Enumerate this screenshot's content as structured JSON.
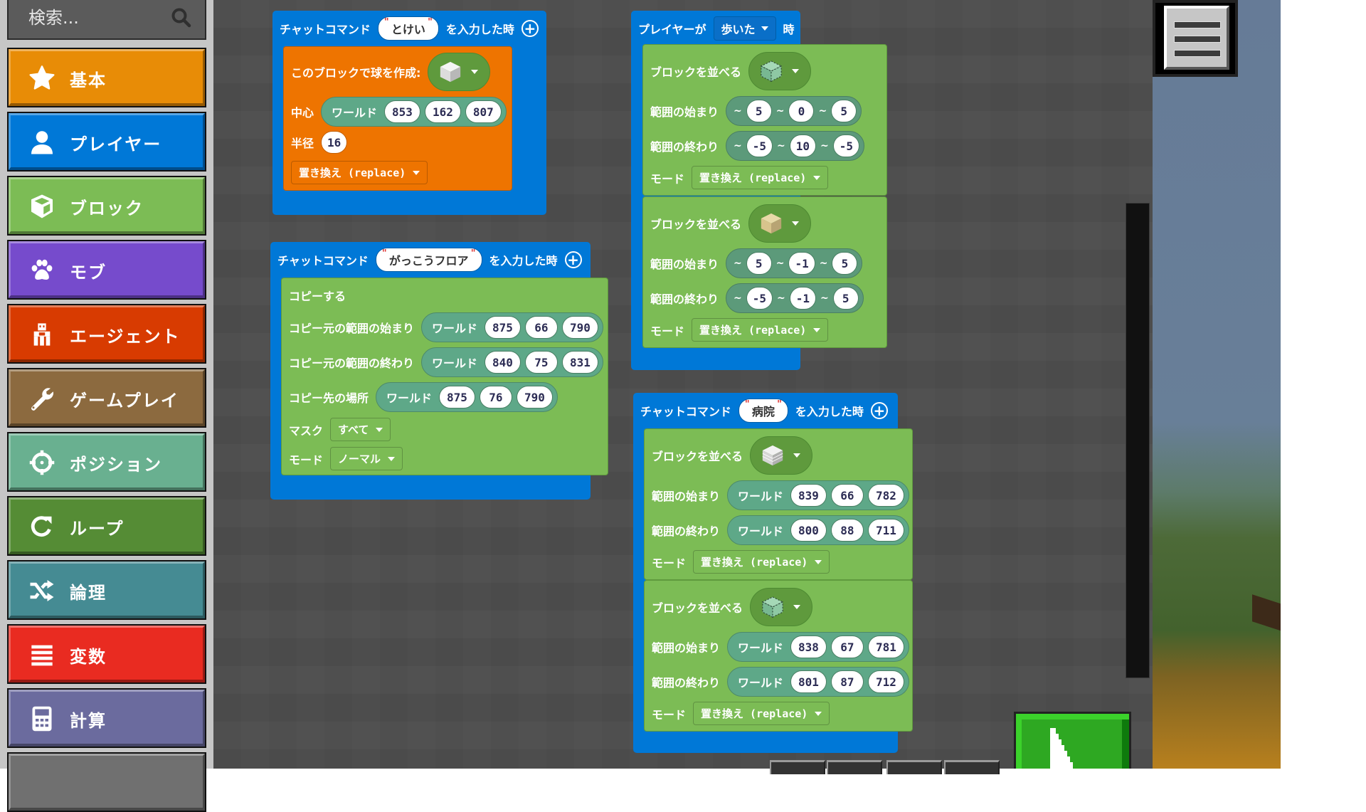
{
  "search": {
    "placeholder": "検索...",
    "icon": "search-icon"
  },
  "categories": [
    {
      "label": "基本",
      "icon": "star-icon",
      "color": "#e88c06"
    },
    {
      "label": "プレイヤー",
      "icon": "person-icon",
      "color": "#0078d7"
    },
    {
      "label": "ブロック",
      "icon": "cube-icon",
      "color": "#7cbc55"
    },
    {
      "label": "モブ",
      "icon": "paw-icon",
      "color": "#764bcc"
    },
    {
      "label": "エージェント",
      "icon": "agent-icon",
      "color": "#d83b01"
    },
    {
      "label": "ゲームプレイ",
      "icon": "wrench-icon",
      "color": "#8c6a3f"
    },
    {
      "label": "ポジション",
      "icon": "crosshair-icon",
      "color": "#69b090"
    },
    {
      "label": "ループ",
      "icon": "loop-icon",
      "color": "#558c35"
    },
    {
      "label": "論理",
      "icon": "shuffle-icon",
      "color": "#458b93"
    },
    {
      "label": "変数",
      "icon": "list-icon",
      "color": "#e92b21"
    },
    {
      "label": "計算",
      "icon": "calculator-icon",
      "color": "#6b6b9e"
    },
    {
      "label": "",
      "icon": "",
      "color": "#707070"
    }
  ],
  "colors": {
    "event": "#0078d7",
    "shapes": "#ee7400",
    "blocks": "#7cbc55",
    "position": "#5ea888",
    "canvas": "#4d4d4d",
    "sidebar": "#c6c6c6"
  },
  "scripts": {
    "clock": {
      "prefix": "チャットコマンド",
      "command": "とけい",
      "suffix": "を入力した時",
      "body": {
        "title": "このブロックで球を作成:",
        "block_icon": "white-block-icon",
        "center_label": "中心",
        "world_label": "ワールド",
        "center": [
          "853",
          "162",
          "807"
        ],
        "radius_label": "半径",
        "radius": "16",
        "mode": "置き換え (replace)"
      }
    },
    "school_floor": {
      "prefix": "チャットコマンド",
      "command": "がっこうフロア",
      "suffix": "を入力した時",
      "body": {
        "title": "コピーする",
        "src_start_label": "コピー元の範囲の始まり",
        "src_start": [
          "875",
          "66",
          "790"
        ],
        "src_end_label": "コピー元の範囲の終わり",
        "src_end": [
          "840",
          "75",
          "831"
        ],
        "dest_label": "コピー先の場所",
        "dest": [
          "875",
          "76",
          "790"
        ],
        "world_label": "ワールド",
        "mask_label": "マスク",
        "mask": "すべて",
        "mode_label": "モード",
        "mode": "ノーマル"
      }
    },
    "player_walked": {
      "prefix": "プレイヤーが",
      "event": "歩いた",
      "suffix": "時",
      "fills": [
        {
          "title": "ブロックを並べる",
          "block_icon": "air-block-icon",
          "start_label": "範囲の始まり",
          "start": [
            "5",
            "0",
            "5"
          ],
          "end_label": "範囲の終わり",
          "end": [
            "-5",
            "10",
            "-5"
          ],
          "mode_label": "モード",
          "mode": "置き換え (replace)"
        },
        {
          "title": "ブロックを並べる",
          "block_icon": "sandstone-block-icon",
          "start_label": "範囲の始まり",
          "start": [
            "5",
            "-1",
            "5"
          ],
          "end_label": "範囲の終わり",
          "end": [
            "-5",
            "-1",
            "5"
          ],
          "mode_label": "モード",
          "mode": "置き換え (replace)"
        }
      ],
      "tilde": "~"
    },
    "hospital": {
      "prefix": "チャットコマンド",
      "command": "病院",
      "suffix": "を入力した時",
      "world_label": "ワールド",
      "fills": [
        {
          "title": "ブロックを並べる",
          "block_icon": "quartz-block-icon",
          "start_label": "範囲の始まり",
          "start": [
            "839",
            "66",
            "782"
          ],
          "end_label": "範囲の終わり",
          "end": [
            "800",
            "88",
            "711"
          ],
          "mode_label": "モード",
          "mode": "置き換え (replace)"
        },
        {
          "title": "ブロックを並べる",
          "block_icon": "air-block-icon",
          "start_label": "範囲の始まり",
          "start": [
            "838",
            "67",
            "781"
          ],
          "end_label": "範囲の終わり",
          "end": [
            "801",
            "87",
            "712"
          ],
          "mode_label": "モード",
          "mode": "置き換え (replace)"
        }
      ]
    }
  },
  "controls": {
    "menu_icon": "hamburger-icon",
    "run_icon": "cursor-arrow-icon"
  }
}
